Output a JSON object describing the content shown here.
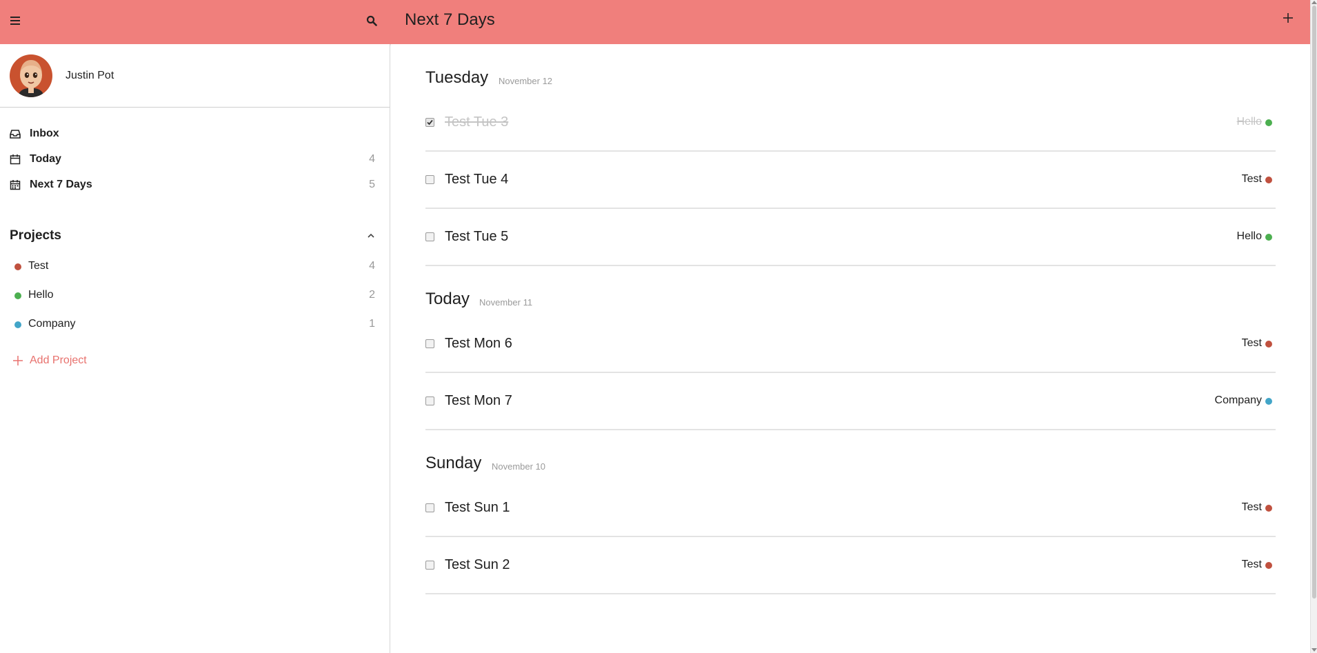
{
  "colors": {
    "header_bg": "#f07f7c",
    "accent": "#e8716d",
    "project_test": "#c0513f",
    "project_hello": "#4caf50",
    "project_company": "#42a5c8"
  },
  "header": {
    "menu_icon": "hamburger-icon",
    "search_icon": "search-icon",
    "title": "Next 7 Days",
    "add_icon": "plus-icon"
  },
  "user": {
    "name": "Justin Pot",
    "avatar_icon": "avatar-cartoon"
  },
  "nav": [
    {
      "label": "Inbox",
      "icon": "inbox-icon",
      "count": ""
    },
    {
      "label": "Today",
      "icon": "calendar-icon",
      "count": "4"
    },
    {
      "label": "Next 7 Days",
      "icon": "calendar-grid-icon",
      "count": "5"
    }
  ],
  "projects": {
    "title": "Projects",
    "toggle_icon": "chevron-up-icon",
    "items": [
      {
        "label": "Test",
        "count": "4",
        "color": "#c0513f"
      },
      {
        "label": "Hello",
        "count": "2",
        "color": "#4caf50"
      },
      {
        "label": "Company",
        "count": "1",
        "color": "#42a5c8"
      }
    ],
    "add_label": "Add Project"
  },
  "days": [
    {
      "name": "Tuesday",
      "date": "November 12",
      "tasks": [
        {
          "title": "Test Tue 3",
          "project": "Hello",
          "color": "#4caf50",
          "done": true
        },
        {
          "title": "Test Tue 4",
          "project": "Test",
          "color": "#c0513f",
          "done": false
        },
        {
          "title": "Test Tue 5",
          "project": "Hello",
          "color": "#4caf50",
          "done": false
        }
      ]
    },
    {
      "name": "Today",
      "date": "November 11",
      "tasks": [
        {
          "title": "Test Mon 6",
          "project": "Test",
          "color": "#c0513f",
          "done": false
        },
        {
          "title": "Test Mon 7",
          "project": "Company",
          "color": "#42a5c8",
          "done": false
        }
      ]
    },
    {
      "name": "Sunday",
      "date": "November 10",
      "tasks": [
        {
          "title": "Test Sun 1",
          "project": "Test",
          "color": "#c0513f",
          "done": false
        },
        {
          "title": "Test Sun 2",
          "project": "Test",
          "color": "#c0513f",
          "done": false
        }
      ]
    }
  ]
}
